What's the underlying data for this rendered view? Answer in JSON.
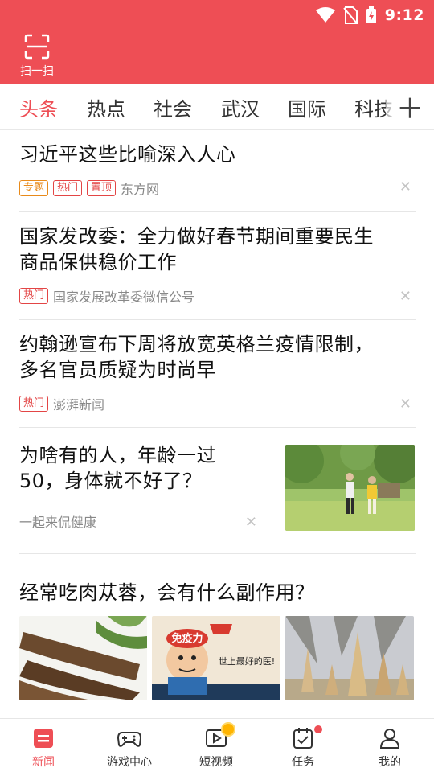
{
  "status_bar": {
    "time": "9:12"
  },
  "header": {
    "scan_label": "扫一扫"
  },
  "tabs": [
    {
      "label": "头条",
      "active": true
    },
    {
      "label": "热点"
    },
    {
      "label": "社会"
    },
    {
      "label": "武汉"
    },
    {
      "label": "国际"
    },
    {
      "label": "科技"
    }
  ],
  "feed": [
    {
      "title": "习近平这些比喻深入人心",
      "tags": [
        "专题",
        "热门",
        "置顶"
      ],
      "source": "东方网"
    },
    {
      "title_line1": "国家发改委：全力做好春节期间重要民生",
      "title_line2": "商品保供稳价工作",
      "tags": [
        "热门"
      ],
      "source": "国家发展改革委微信公号"
    },
    {
      "title_line1": "约翰逊宣布下周将放宽英格兰疫情限制，",
      "title_line2": "多名官员质疑为时尚早",
      "tags": [
        "热门"
      ],
      "source": "澎湃新闻"
    },
    {
      "title_line1": "为啥有的人，年龄一过",
      "title_line2": "50，身体就不好了？",
      "source": "一起来侃健康"
    },
    {
      "title": "经常吃肉苁蓉，会有什么副作用？",
      "image2_text_top": "免疫力",
      "image2_text_side": "世上最好的医!"
    }
  ],
  "bottom_nav": [
    {
      "label": "新闻",
      "icon": "news-icon",
      "active": true
    },
    {
      "label": "游戏中心",
      "icon": "gamepad-icon"
    },
    {
      "label": "短视频",
      "icon": "video-icon"
    },
    {
      "label": "任务",
      "icon": "task-icon"
    },
    {
      "label": "我的",
      "icon": "profile-icon"
    }
  ],
  "colors": {
    "brand": "#ee4e55",
    "tag_orange": "#e88a1a",
    "tag_red": "#e34545"
  }
}
